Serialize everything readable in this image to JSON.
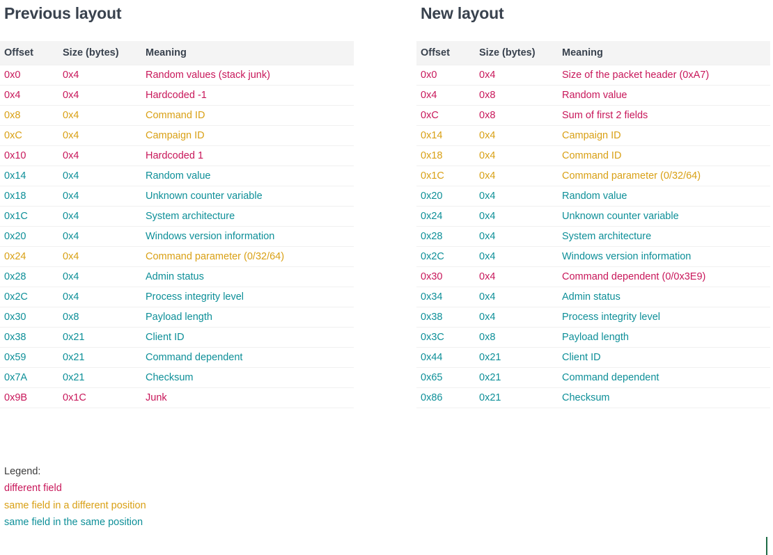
{
  "legend_colors": {
    "different_field": "#c8175a",
    "same_field_different_position": "#d9a015",
    "same_field_same_position": "#0d8f98",
    "title": "#39424e",
    "header_background": "#f4f4f4",
    "row_divider": "#f0f0f0",
    "edge_marker": "#1d6b45"
  },
  "columns": {
    "offset": "Offset",
    "size": "Size (bytes)",
    "meaning": "Meaning"
  },
  "panels": [
    {
      "title": "Previous layout",
      "rows": [
        {
          "offset": "0x0",
          "size": "0x4",
          "meaning": "Random values (stack junk)",
          "category": "diff"
        },
        {
          "offset": "0x4",
          "size": "0x4",
          "meaning": "Hardcoded -1",
          "category": "diff"
        },
        {
          "offset": "0x8",
          "size": "0x4",
          "meaning": "Command ID",
          "category": "diffpos"
        },
        {
          "offset": "0xC",
          "size": "0x4",
          "meaning": "Campaign ID",
          "category": "diffpos"
        },
        {
          "offset": "0x10",
          "size": "0x4",
          "meaning": "Hardcoded 1",
          "category": "diff"
        },
        {
          "offset": "0x14",
          "size": "0x4",
          "meaning": "Random value",
          "category": "samepos"
        },
        {
          "offset": "0x18",
          "size": "0x4",
          "meaning": "Unknown counter variable",
          "category": "samepos"
        },
        {
          "offset": "0x1C",
          "size": "0x4",
          "meaning": "System architecture",
          "category": "samepos"
        },
        {
          "offset": "0x20",
          "size": "0x4",
          "meaning": "Windows version information",
          "category": "samepos"
        },
        {
          "offset": "0x24",
          "size": "0x4",
          "meaning": "Command parameter (0/32/64)",
          "category": "diffpos"
        },
        {
          "offset": "0x28",
          "size": "0x4",
          "meaning": "Admin status",
          "category": "samepos"
        },
        {
          "offset": "0x2C",
          "size": "0x4",
          "meaning": "Process integrity level",
          "category": "samepos"
        },
        {
          "offset": "0x30",
          "size": "0x8",
          "meaning": "Payload length",
          "category": "samepos"
        },
        {
          "offset": "0x38",
          "size": "0x21",
          "meaning": "Client ID",
          "category": "samepos"
        },
        {
          "offset": "0x59",
          "size": "0x21",
          "meaning": "Command dependent",
          "category": "samepos"
        },
        {
          "offset": "0x7A",
          "size": "0x21",
          "meaning": "Checksum",
          "category": "samepos"
        },
        {
          "offset": "0x9B",
          "size": "0x1C",
          "meaning": "Junk",
          "category": "diff"
        }
      ]
    },
    {
      "title": "New layout",
      "rows": [
        {
          "offset": "0x0",
          "size": "0x4",
          "meaning": "Size of the packet header (0xA7)",
          "category": "diff"
        },
        {
          "offset": "0x4",
          "size": "0x8",
          "meaning": "Random value",
          "category": "diff"
        },
        {
          "offset": "0xC",
          "size": "0x8",
          "meaning": "Sum of first 2 fields",
          "category": "diff"
        },
        {
          "offset": "0x14",
          "size": "0x4",
          "meaning": "Campaign ID",
          "category": "diffpos"
        },
        {
          "offset": "0x18",
          "size": "0x4",
          "meaning": "Command ID",
          "category": "diffpos"
        },
        {
          "offset": "0x1C",
          "size": "0x4",
          "meaning": "Command parameter (0/32/64)",
          "category": "diffpos"
        },
        {
          "offset": "0x20",
          "size": "0x4",
          "meaning": "Random value",
          "category": "samepos"
        },
        {
          "offset": "0x24",
          "size": "0x4",
          "meaning": "Unknown counter variable",
          "category": "samepos"
        },
        {
          "offset": "0x28",
          "size": "0x4",
          "meaning": "System architecture",
          "category": "samepos"
        },
        {
          "offset": "0x2C",
          "size": "0x4",
          "meaning": "Windows version information",
          "category": "samepos"
        },
        {
          "offset": "0x30",
          "size": "0x4",
          "meaning": "Command dependent (0/0x3E9)",
          "category": "diff"
        },
        {
          "offset": "0x34",
          "size": "0x4",
          "meaning": "Admin status",
          "category": "samepos"
        },
        {
          "offset": "0x38",
          "size": "0x4",
          "meaning": "Process integrity level",
          "category": "samepos"
        },
        {
          "offset": "0x3C",
          "size": "0x8",
          "meaning": "Payload length",
          "category": "samepos"
        },
        {
          "offset": "0x44",
          "size": "0x21",
          "meaning": "Client ID",
          "category": "samepos"
        },
        {
          "offset": "0x65",
          "size": "0x21",
          "meaning": "Command dependent",
          "category": "samepos"
        },
        {
          "offset": "0x86",
          "size": "0x21",
          "meaning": "Checksum",
          "category": "samepos"
        }
      ]
    }
  ],
  "legend": {
    "title": "Legend:",
    "items": [
      {
        "label": "different field",
        "category": "diff"
      },
      {
        "label": "same field in a different position",
        "category": "diffpos"
      },
      {
        "label": "same field in the same position",
        "category": "samepos"
      }
    ]
  }
}
